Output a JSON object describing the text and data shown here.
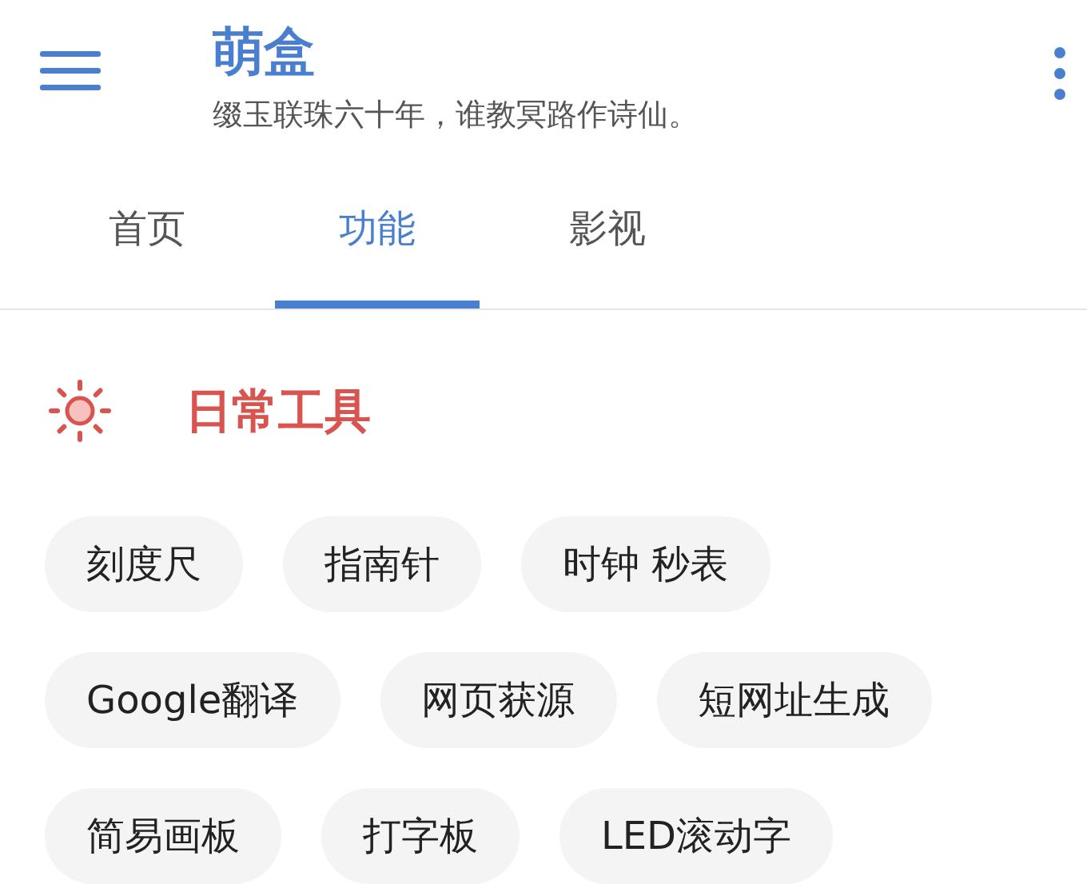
{
  "app_bar": {
    "title": "萌盒",
    "subtitle": "缀玉联珠六十年，谁教冥路作诗仙。"
  },
  "tabs": [
    {
      "label": "首页",
      "selected": false
    },
    {
      "label": "功能",
      "selected": true
    },
    {
      "label": "影视",
      "selected": false
    }
  ],
  "section": {
    "title": "日常工具"
  },
  "chip_rows": [
    [
      "刻度尺",
      "指南针",
      "时钟 秒表"
    ],
    [
      "Google翻译",
      "网页获源",
      "短网址生成"
    ],
    [
      "简易画板",
      "打字板",
      "LED滚动字"
    ]
  ]
}
